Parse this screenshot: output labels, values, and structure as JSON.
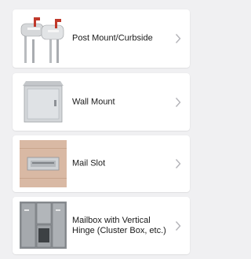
{
  "options": [
    {
      "label": "Post Mount/Curbside",
      "icon": "curbside-mailbox-image"
    },
    {
      "label": "Wall Mount",
      "icon": "wall-mount-mailbox-image"
    },
    {
      "label": "Mail Slot",
      "icon": "mail-slot-image"
    },
    {
      "label": "Mailbox with Vertical Hinge (Cluster Box, etc.)",
      "icon": "cluster-box-image"
    }
  ],
  "chevron_icon": "chevron-right-icon"
}
